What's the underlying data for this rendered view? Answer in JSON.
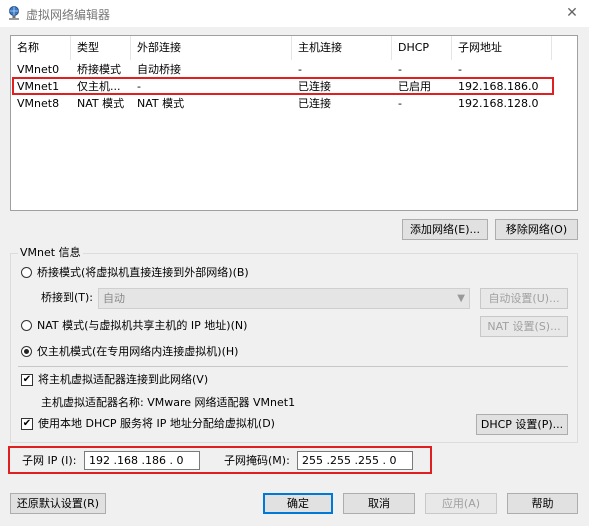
{
  "window": {
    "title": "虚拟网络编辑器"
  },
  "list": {
    "columns": [
      "名称",
      "类型",
      "外部连接",
      "主机连接",
      "DHCP",
      "子网地址"
    ],
    "rows": [
      [
        "VMnet0",
        "桥接模式",
        "自动桥接",
        "-",
        "-",
        "-"
      ],
      [
        "VMnet1",
        "仅主机...",
        "-",
        "已连接",
        "已启用",
        "192.168.186.0"
      ],
      [
        "VMnet8",
        "NAT 模式",
        "NAT 模式",
        "已连接",
        "-",
        "192.168.128.0"
      ]
    ]
  },
  "list_buttons": {
    "add": "添加网络(E)...",
    "remove": "移除网络(O)"
  },
  "vmnet_info": {
    "title": "VMnet 信息",
    "bridged_mode": "桥接模式(将虚拟机直接连接到外部网络)(B)",
    "bridged_to_label": "桥接到(T):",
    "bridged_to_value": "自动",
    "auto_settings": "自动设置(U)...",
    "nat_mode": "NAT 模式(与虚拟机共享主机的 IP 地址)(N)",
    "nat_settings": "NAT 设置(S)...",
    "host_only_mode": "仅主机模式(在专用网络内连接虚拟机)(H)",
    "connect_adapter": "将主机虚拟适配器连接到此网络(V)",
    "adapter_name_label": "主机虚拟适配器名称: VMware 网络适配器 VMnet1",
    "use_dhcp": "使用本地 DHCP 服务将 IP 地址分配给虚拟机(D)",
    "dhcp_settings": "DHCP 设置(P)...",
    "subnet_ip_label": "子网 IP (I):",
    "subnet_ip_value": "192 .168 .186 . 0",
    "subnet_mask_label": "子网掩码(M):",
    "subnet_mask_value": "255 .255 .255 . 0",
    "selected_mode": "host_only",
    "connect_adapter_checked": true,
    "use_dhcp_checked": true
  },
  "footer": {
    "restore": "还原默认设置(R)",
    "ok": "确定",
    "cancel": "取消",
    "apply": "应用(A)",
    "help": "帮助"
  },
  "colors": {
    "highlight": "#e02020",
    "accent": "#0078d7"
  }
}
